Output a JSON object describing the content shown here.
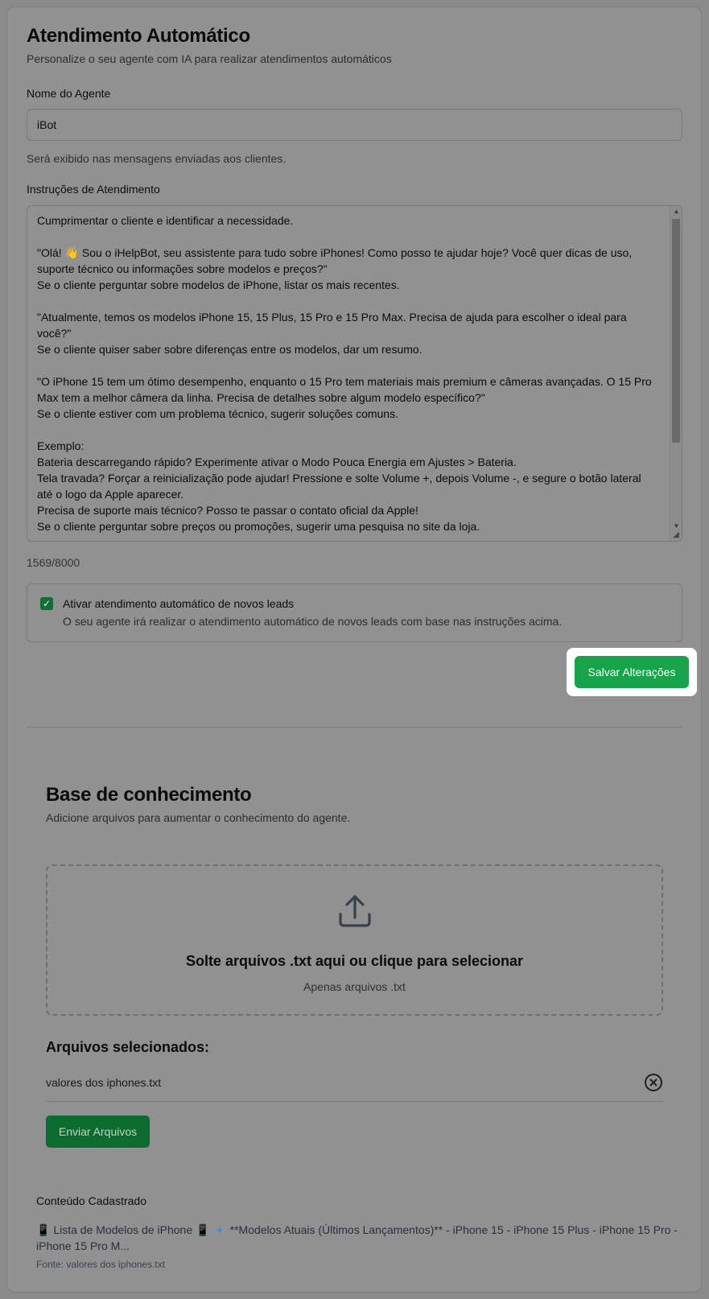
{
  "header": {
    "title": "Atendimento Automático",
    "subtitle": "Personalize o seu agente com IA para realizar atendimentos automáticos"
  },
  "agent_name": {
    "label": "Nome do Agente",
    "value": "iBot",
    "hint": "Será exibido nas mensagens enviadas aos clientes."
  },
  "instructions": {
    "label": "Instruções de Atendimento",
    "value": "Cumprimentar o cliente e identificar a necessidade.\n\n\"Olá! 👋 Sou o iHelpBot, seu assistente para tudo sobre iPhones! Como posso te ajudar hoje? Você quer dicas de uso, suporte técnico ou informações sobre modelos e preços?\"\nSe o cliente perguntar sobre modelos de iPhone, listar os mais recentes.\n\n\"Atualmente, temos os modelos iPhone 15, 15 Plus, 15 Pro e 15 Pro Max. Precisa de ajuda para escolher o ideal para você?\"\nSe o cliente quiser saber sobre diferenças entre os modelos, dar um resumo.\n\n\"O iPhone 15 tem um ótimo desempenho, enquanto o 15 Pro tem materiais mais premium e câmeras avançadas. O 15 Pro Max tem a melhor câmera da linha. Precisa de detalhes sobre algum modelo específico?\"\nSe o cliente estiver com um problema técnico, sugerir soluções comuns.\n\nExemplo:\nBateria descarregando rápido? Experimente ativar o Modo Pouca Energia em Ajustes > Bateria.\nTela travada? Forçar a reinicialização pode ajudar! Pressione e solte Volume +, depois Volume -, e segure o botão lateral até o logo da Apple aparecer.\nPrecisa de suporte mais técnico? Posso te passar o contato oficial da Apple!\nSe o cliente perguntar sobre preços ou promoções, sugerir uma pesquisa no site da loja.",
    "counter": "1569/8000"
  },
  "auto_leads": {
    "checked": true,
    "label": "Ativar atendimento automático de novos leads",
    "description": "O seu agente irá realizar o atendimento automático de novos leads com base nas instruções acima."
  },
  "save_button": "Salvar Alterações",
  "knowledge_base": {
    "title": "Base de conhecimento",
    "subtitle": "Adicione arquivos para aumentar o conhecimento do agente.",
    "dropzone_title": "Solte arquivos .txt aqui ou clique para selecionar",
    "dropzone_sub": "Apenas arquivos .txt",
    "selected_title": "Arquivos selecionados:",
    "files": [
      {
        "name": "valores dos iphones.txt"
      }
    ],
    "send_button": "Enviar Arquivos"
  },
  "registered_content": {
    "title": "Conteúdo Cadastrado",
    "text": "📱 Lista de Modelos de iPhone 📱 🔹 **Modelos Atuais (Últimos Lançamentos)** - iPhone 15 - iPhone 15 Plus - iPhone 15 Pro - iPhone 15 Pro M...",
    "source": "Fonte: valores dos iphones.txt"
  },
  "colors": {
    "overlay": "#8a8a8a",
    "primary_button": "#16a34a",
    "send_button_dimmed": "#0c6b2f",
    "highlight": "#ffffff"
  },
  "icons": {
    "upload": "upload-icon",
    "remove": "close-circle-icon",
    "checkbox": "check-icon"
  }
}
